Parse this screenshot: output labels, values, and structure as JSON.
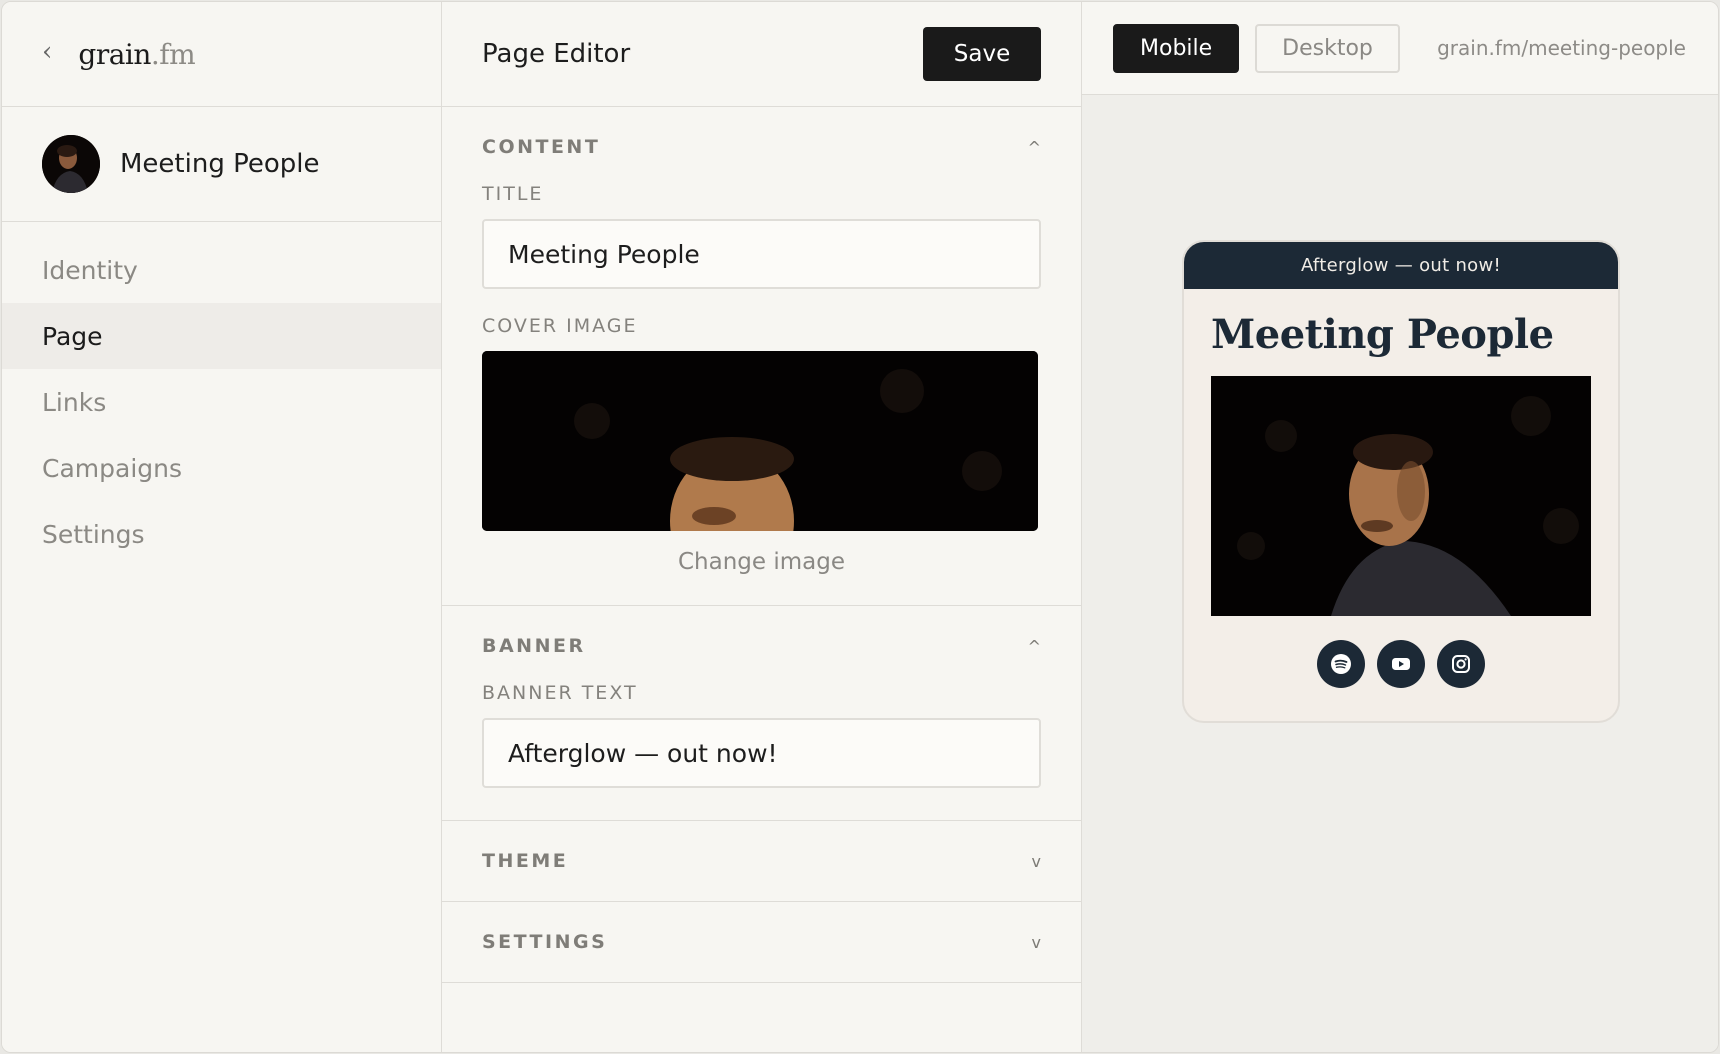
{
  "brand": {
    "back_glyph": "‹",
    "name": "grain",
    "ext": ".fm"
  },
  "artist": {
    "name": "Meeting People"
  },
  "nav": {
    "items": [
      {
        "label": "Identity"
      },
      {
        "label": "Page"
      },
      {
        "label": "Links"
      },
      {
        "label": "Campaigns"
      },
      {
        "label": "Settings"
      }
    ],
    "active": "Page"
  },
  "editor": {
    "title": "Page Editor",
    "save_label": "Save",
    "sections": {
      "content": {
        "label": "CONTENT",
        "chevron": "^",
        "title_label": "TITLE",
        "title_value": "Meeting People",
        "cover_label": "COVER IMAGE",
        "change_image": "Change image"
      },
      "banner": {
        "label": "BANNER",
        "chevron": "^",
        "text_label": "BANNER TEXT",
        "text_value": "Afterglow — out now!"
      },
      "theme": {
        "label": "THEME",
        "chevron": "v"
      },
      "settings": {
        "label": "SETTINGS",
        "chevron": "v"
      }
    }
  },
  "preview": {
    "mobile_label": "Mobile",
    "desktop_label": "Desktop",
    "selected_view": "Mobile",
    "url": "grain.fm/meeting-people",
    "banner_text": "Afterglow — out now!",
    "page_title": "Meeting People",
    "socials": [
      {
        "icon": "spotify-icon"
      },
      {
        "icon": "youtube-icon"
      },
      {
        "icon": "instagram-icon"
      }
    ]
  },
  "colors": {
    "background": "#f7f6f2",
    "dark_button": "#1a1a1a",
    "preview_navy": "#1c2936",
    "preview_card": "#f3eee8"
  }
}
